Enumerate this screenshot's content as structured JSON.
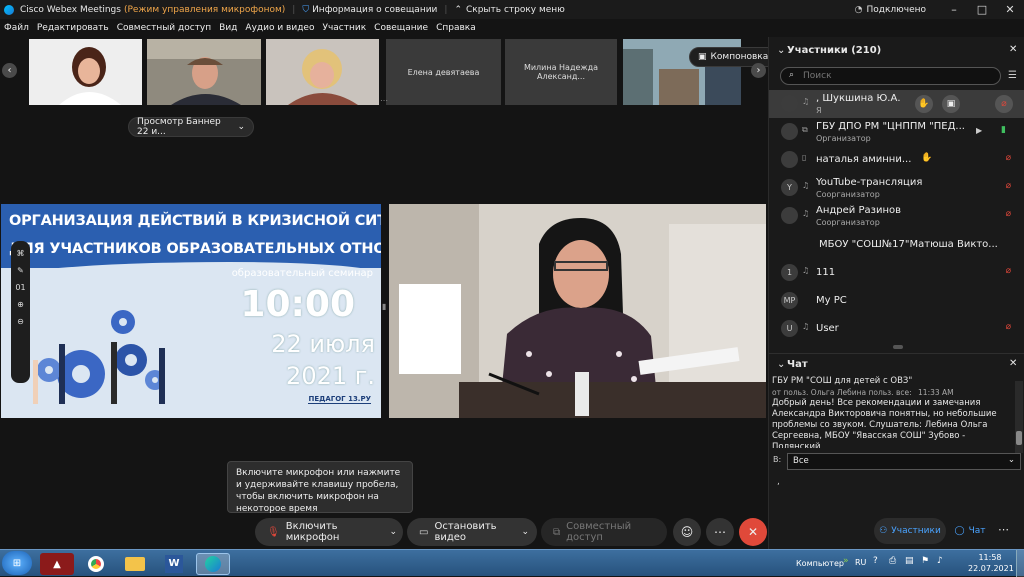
{
  "titlebar": {
    "app": "Cisco Webex Meetings",
    "mode": "(Режим управления микрофоном)",
    "meeting_info": "Информация о совещании",
    "hide_menu": "Скрыть строку меню",
    "connection": "Подключено"
  },
  "menu": [
    "Файл",
    "Редактировать",
    "Совместный доступ",
    "Вид",
    "Аудио и видео",
    "Участник",
    "Совещание",
    "Справка"
  ],
  "strip": {
    "names": [
      "Елена девятаева",
      "Милина Надежда Александ..."
    ],
    "layout_button": "Компоновка",
    "viewing_label": "Просмотр Баннер 22 и..."
  },
  "banner": {
    "line1": "ОРГАНИЗАЦИЯ ДЕЙСТВИЙ В КРИЗИСНОЙ СИТУАЦИИ",
    "line2": "ДЛЯ УЧАСТНИКОВ ОБРАЗОВАТЕЛЬНЫХ ОТНОШЕНИЙ",
    "subtitle": "образовательный семинар",
    "time": "10:00",
    "date": "22 июля",
    "year": "2021 г.",
    "brand": "ПЕДАГОГ 13.РУ",
    "page_number": "01"
  },
  "tooltip": "Включите микрофон или нажмите и удерживайте клавишу пробела, чтобы включить микрофон на некоторое время",
  "controls": {
    "unmute": "Включить микрофон",
    "stop_video": "Остановить видео",
    "share": "Совместный доступ"
  },
  "participants": {
    "header": "Участники (210)",
    "search_placeholder": "Поиск",
    "list": [
      {
        "avatar": "",
        "name": ", Шукшина Ю.А.",
        "role": "Я"
      },
      {
        "avatar": "",
        "name": "ГБУ ДПО РМ \"ЦНППМ \"ПЕД...",
        "role": "Организатор"
      },
      {
        "avatar": "",
        "name": "наталья аминни...",
        "role": ""
      },
      {
        "avatar": "Y",
        "name": "YouTube-трансляция",
        "role": "Соорганизатор"
      },
      {
        "avatar": "",
        "name": "Андрей Разинов",
        "role": "Соорганизатор"
      },
      {
        "avatar": "",
        "name": "МБОУ \"СОШ№17\"Матюша Викто...",
        "role": ""
      },
      {
        "avatar": "1",
        "name": "111",
        "role": ""
      },
      {
        "avatar": "MP",
        "name": "My PC",
        "role": ""
      },
      {
        "avatar": "U",
        "name": "User",
        "role": ""
      }
    ]
  },
  "chat": {
    "header": "Чат",
    "line0": "ГБУ РМ \"СОШ для детей с ОВЗ\"",
    "meta": "от польз. Ольга Лебина польз. все:",
    "meta_time": "11:33 AM",
    "message": "Добрый день! Все рекомендации и замечания Александра Викторовича понятны, но небольшие проблемы со звуком. Слушатель: Лебина Ольга Сергеевна, МБОУ \"Явасская СОШ\" Зубово - Полянский",
    "to_label": "В:",
    "to_value": "Все"
  },
  "panel_tabs": {
    "participants": "Участники",
    "chat": "Чат"
  },
  "taskbar": {
    "computer": "Компьютер",
    "lang": "RU",
    "time": "11:58",
    "date": "22.07.2021"
  },
  "colors": {
    "accent_blue": "#2b5fb0",
    "mute_red": "#e0473a",
    "leave_red": "#e0493a",
    "tab_active": "#4aa3ff"
  }
}
